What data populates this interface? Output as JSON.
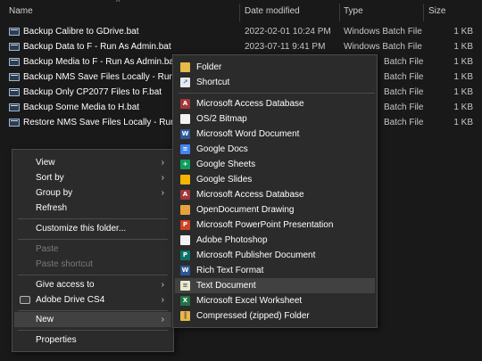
{
  "columns": {
    "name": "Name",
    "date": "Date modified",
    "type": "Type",
    "size": "Size"
  },
  "files": [
    {
      "name": "Backup Calibre to GDrive.bat",
      "date": "2022-02-01 10:24 PM",
      "type": "Windows Batch File",
      "size": "1 KB"
    },
    {
      "name": "Backup Data to F - Run As Admin.bat",
      "date": "2023-07-11 9:41 PM",
      "type": "Windows Batch File",
      "size": "1 KB"
    },
    {
      "name": "Backup Media to F - Run As Admin.bat",
      "date": "",
      "type": "Batch File",
      "size": "1 KB"
    },
    {
      "name": "Backup NMS Save Files Locally - Run As",
      "date": "",
      "type": "Batch File",
      "size": "1 KB"
    },
    {
      "name": "Backup Only CP2077 Files to F.bat",
      "date": "",
      "type": "Batch File",
      "size": "1 KB"
    },
    {
      "name": "Backup Some Media to H.bat",
      "date": "",
      "type": "Batch File",
      "size": "1 KB"
    },
    {
      "name": "Restore NMS Save Files Locally - Run As",
      "date": "",
      "type": "Batch File",
      "size": "1 KB"
    }
  ],
  "context_menu": {
    "view": "View",
    "sort_by": "Sort by",
    "group_by": "Group by",
    "refresh": "Refresh",
    "customize": "Customize this folder...",
    "paste": "Paste",
    "paste_shortcut": "Paste shortcut",
    "give_access": "Give access to",
    "adobe_drive": "Adobe Drive CS4",
    "new": "New",
    "properties": "Properties"
  },
  "new_menu": {
    "folder": "Folder",
    "shortcut": "Shortcut",
    "items": [
      "Microsoft Access Database",
      "OS/2 Bitmap",
      "Microsoft Word Document",
      "Google Docs",
      "Google Sheets",
      "Google Slides",
      "Microsoft Access Database",
      "OpenDocument Drawing",
      "Microsoft PowerPoint Presentation",
      "Adobe Photoshop",
      "Microsoft Publisher Document",
      "Rich Text Format",
      "Text Document",
      "Microsoft Excel Worksheet",
      "Compressed (zipped) Folder"
    ]
  },
  "colors": {
    "background": "#191919",
    "menu_bg": "#2b2b2b",
    "highlight": "#414141"
  }
}
